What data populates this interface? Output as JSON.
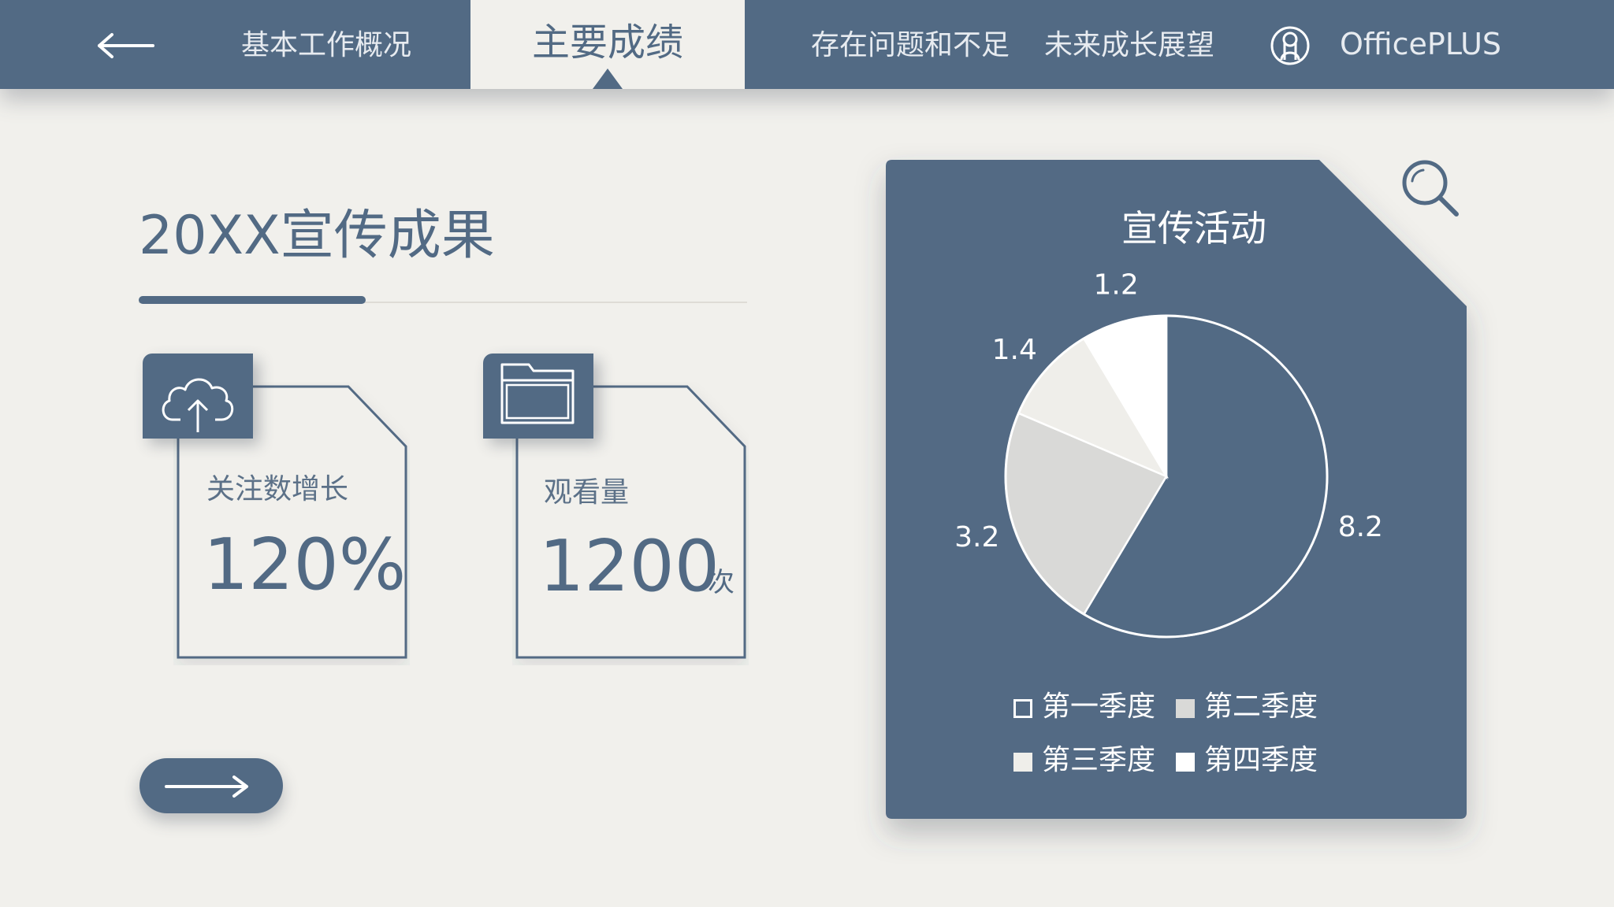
{
  "nav": {
    "tabs": [
      {
        "label": "基本工作概况"
      },
      {
        "label": "主要成绩"
      },
      {
        "label": "存在问题和不足"
      },
      {
        "label": "未来成长展望"
      }
    ],
    "active_index": 1,
    "brand": "OfficePLUS"
  },
  "main": {
    "title": "20XX宣传成果",
    "cards": [
      {
        "label": "关注数增长",
        "value": "120%",
        "unit": "",
        "icon": "cloud-upload-icon"
      },
      {
        "label": "观看量",
        "value": "1200",
        "unit": "次",
        "icon": "folder-icon"
      }
    ]
  },
  "chart_data": {
    "type": "pie",
    "title": "宣传活动",
    "categories": [
      "第一季度",
      "第二季度",
      "第三季度",
      "第四季度"
    ],
    "values": [
      8.2,
      3.2,
      1.4,
      1.2
    ],
    "slice_colors": [
      "#526a84",
      "#d9d9d7",
      "#efeeea",
      "#ffffff"
    ],
    "legend": [
      {
        "label": "第一季度",
        "swatch": "outline"
      },
      {
        "label": "第二季度",
        "swatch": "#d9d9d7"
      },
      {
        "label": "第三季度",
        "swatch": "#efeeea"
      },
      {
        "label": "第四季度",
        "swatch": "#ffffff"
      }
    ],
    "legend_position": "bottom"
  },
  "colors": {
    "primary": "#526a84",
    "background": "#f1f0ec",
    "nav_text": "#e7ebf0",
    "white": "#ffffff"
  }
}
